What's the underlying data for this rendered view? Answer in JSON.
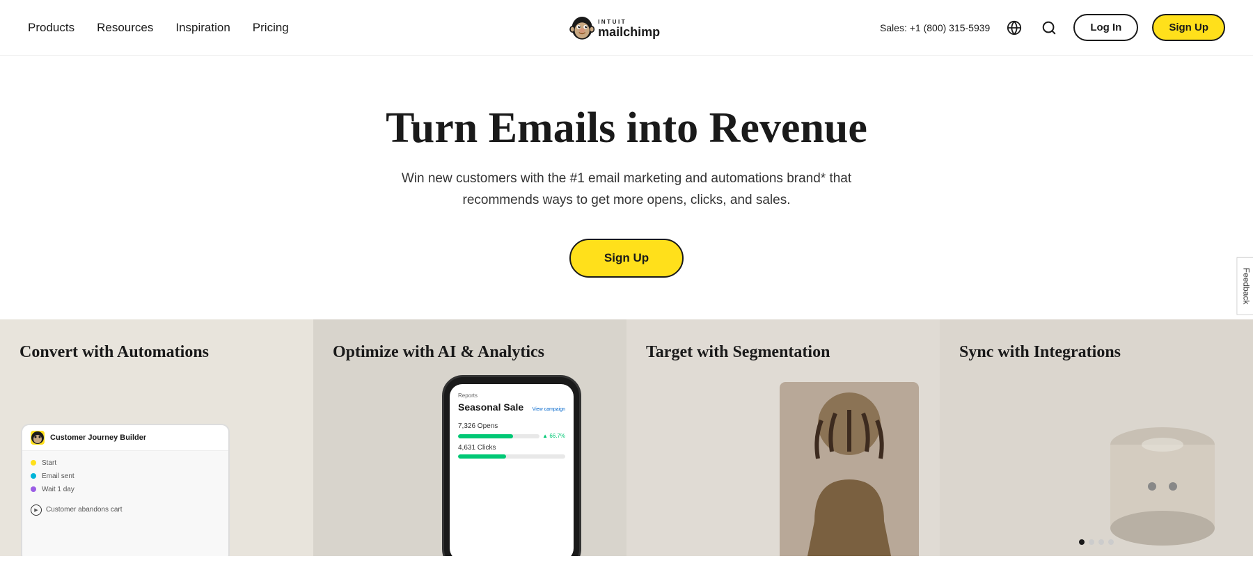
{
  "nav": {
    "links": [
      {
        "label": "Products",
        "id": "products"
      },
      {
        "label": "Resources",
        "id": "resources"
      },
      {
        "label": "Inspiration",
        "id": "inspiration"
      },
      {
        "label": "Pricing",
        "id": "pricing"
      }
    ],
    "logo_alt": "Intuit Mailchimp",
    "sales_text": "Sales: +1 (800) 315-5939",
    "login_label": "Log In",
    "signup_label": "Sign Up"
  },
  "hero": {
    "title": "Turn Emails into Revenue",
    "subtitle": "Win new customers with the #1 email marketing and automations brand* that recommends ways to get more opens, clicks, and sales.",
    "cta_label": "Sign Up"
  },
  "features": [
    {
      "id": "automations",
      "title": "Convert with Automations",
      "ui_label": "Customer Journey Builder",
      "ui_item": "Customer abandons cart"
    },
    {
      "id": "analytics",
      "title": "Optimize with AI & Analytics",
      "campaign_tag": "Reports",
      "campaign_name": "Seasonal Sale",
      "campaign_link": "View campaign",
      "opens_label": "7,326 Opens",
      "opens_change": "▲ 66.7%",
      "clicks_label": "4,631 Clicks",
      "bar_fill_percent": 63
    },
    {
      "id": "segmentation",
      "title": "Target with Segmentation"
    },
    {
      "id": "integrations",
      "title": "Sync with Integrations"
    }
  ],
  "feedback": {
    "label": "Feedback"
  }
}
